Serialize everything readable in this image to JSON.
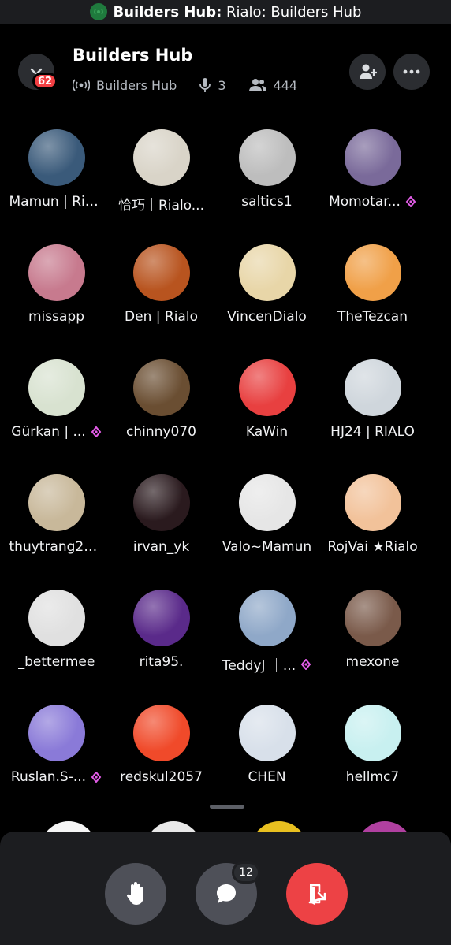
{
  "topbar": {
    "title_bold": "Builders Hub:",
    "title_rest": " Rialo: Builders Hub"
  },
  "header": {
    "title": "Builders Hub",
    "stage_label": "Builders Hub",
    "speakers": "3",
    "listeners": "444",
    "notification_badge": "62"
  },
  "participants": [
    {
      "name": "Mamun | Rialo",
      "gem": false,
      "color": "#3a5a7a"
    },
    {
      "name": "恰巧｜Rialo...",
      "gem": false,
      "color": "#d9d4c8"
    },
    {
      "name": "saltics1",
      "gem": false,
      "color": "#bdbdbd"
    },
    {
      "name": "Momotar...",
      "gem": true,
      "color": "#7a6a9a"
    },
    {
      "name": "missapp",
      "gem": false,
      "color": "#c77a8e"
    },
    {
      "name": "Den | Rialo",
      "gem": false,
      "color": "#b8541f"
    },
    {
      "name": "VincenDialo",
      "gem": false,
      "color": "#e8d6a8"
    },
    {
      "name": "TheTezcan",
      "gem": false,
      "color": "#f0a048"
    },
    {
      "name": "Gürkan | ...",
      "gem": true,
      "color": "#d8e2d0"
    },
    {
      "name": "chinny070",
      "gem": false,
      "color": "#6a4e32"
    },
    {
      "name": "KaWin",
      "gem": false,
      "color": "#e84040"
    },
    {
      "name": "HJ24 | RIALO",
      "gem": false,
      "color": "#cfd6dc"
    },
    {
      "name": "thuytrang27...",
      "gem": false,
      "color": "#c8b89a"
    },
    {
      "name": "irvan_yk",
      "gem": false,
      "color": "#2a1a1e"
    },
    {
      "name": "Valo~Mamun",
      "gem": false,
      "color": "#e6e6e6"
    },
    {
      "name": "RojVai ★Rialo",
      "gem": false,
      "color": "#f2c29a"
    },
    {
      "name": "_bettermee",
      "gem": false,
      "color": "#e0e0e0"
    },
    {
      "name": "rita95.",
      "gem": false,
      "color": "#5a2a8a"
    },
    {
      "name": "TeddyJ ｜...",
      "gem": true,
      "color": "#8fa8c8"
    },
    {
      "name": "mexone",
      "gem": false,
      "color": "#7a5a4a"
    },
    {
      "name": "Ruslan.S-...",
      "gem": true,
      "color": "#8a7ad8"
    },
    {
      "name": "redskul2057",
      "gem": false,
      "color": "#f04a2a"
    },
    {
      "name": "CHEN",
      "gem": false,
      "color": "#d8e0ea"
    },
    {
      "name": "hellmc7",
      "gem": false,
      "color": "#c8f0f0"
    }
  ],
  "controls": {
    "raise_hand": "raise-hand-icon",
    "chat": "chat-icon",
    "chat_badge": "12",
    "leave": "leave-icon",
    "leave_color": "#ed4245"
  }
}
